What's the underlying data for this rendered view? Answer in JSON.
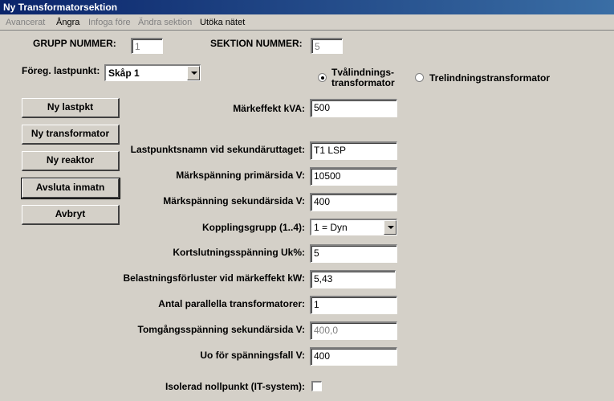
{
  "window": {
    "title": "Ny Transformatorsektion"
  },
  "menu": [
    {
      "label": "Avancerat",
      "enabled": false
    },
    {
      "label": "Ångra",
      "enabled": true
    },
    {
      "label": "Infoga före",
      "enabled": false
    },
    {
      "label": "Ändra sektion",
      "enabled": false
    },
    {
      "label": "Utöka nätet",
      "enabled": true
    }
  ],
  "header": {
    "grupp_label": "GRUPP NUMMER:",
    "grupp_value": "1",
    "sektion_label": "SEKTION NUMMER:",
    "sektion_value": "5",
    "foreg_label": "Föreg. lastpunkt:",
    "foreg_value": "Skåp 1"
  },
  "radios": {
    "two_winding_line1": "Tvålindnings-",
    "two_winding_line2": "transformator",
    "three_winding": "Trelindningstransformator",
    "selected": "two_winding"
  },
  "buttons": {
    "ny_lastpkt": "Ny lastpkt",
    "ny_transformator": "Ny transformator",
    "ny_reaktor": "Ny reaktor",
    "avsluta": "Avsluta inmatn",
    "avbryt": "Avbryt"
  },
  "fields": {
    "markeffekt": {
      "label": "Märkeffekt kVA:",
      "value": "500"
    },
    "lastpunktsnamn": {
      "label": "Lastpunktsnamn vid sekundäruttaget:",
      "value": "T1 LSP"
    },
    "primar": {
      "label": "Märkspänning primärsida V:",
      "value": "10500"
    },
    "sekundar": {
      "label": "Märkspänning sekundärsida V:",
      "value": "400"
    },
    "koppling": {
      "label": "Kopplingsgrupp (1..4):",
      "value": "1 = Dyn"
    },
    "kortslutning": {
      "label": "Kortslutningsspänning Uk%:",
      "value": "5"
    },
    "belastning": {
      "label": "Belastningsförluster vid märkeffekt kW:",
      "value": "5,43"
    },
    "antal": {
      "label": "Antal parallella transformatorer:",
      "value": "1"
    },
    "tomgang": {
      "label": "Tomgångsspänning sekundärsida V:",
      "value": "400,0"
    },
    "uo": {
      "label": "Uo för spänningsfall V:",
      "value": "400"
    },
    "isolerad": {
      "label": "Isolerad nollpunkt (IT-system):",
      "checked": false
    }
  }
}
